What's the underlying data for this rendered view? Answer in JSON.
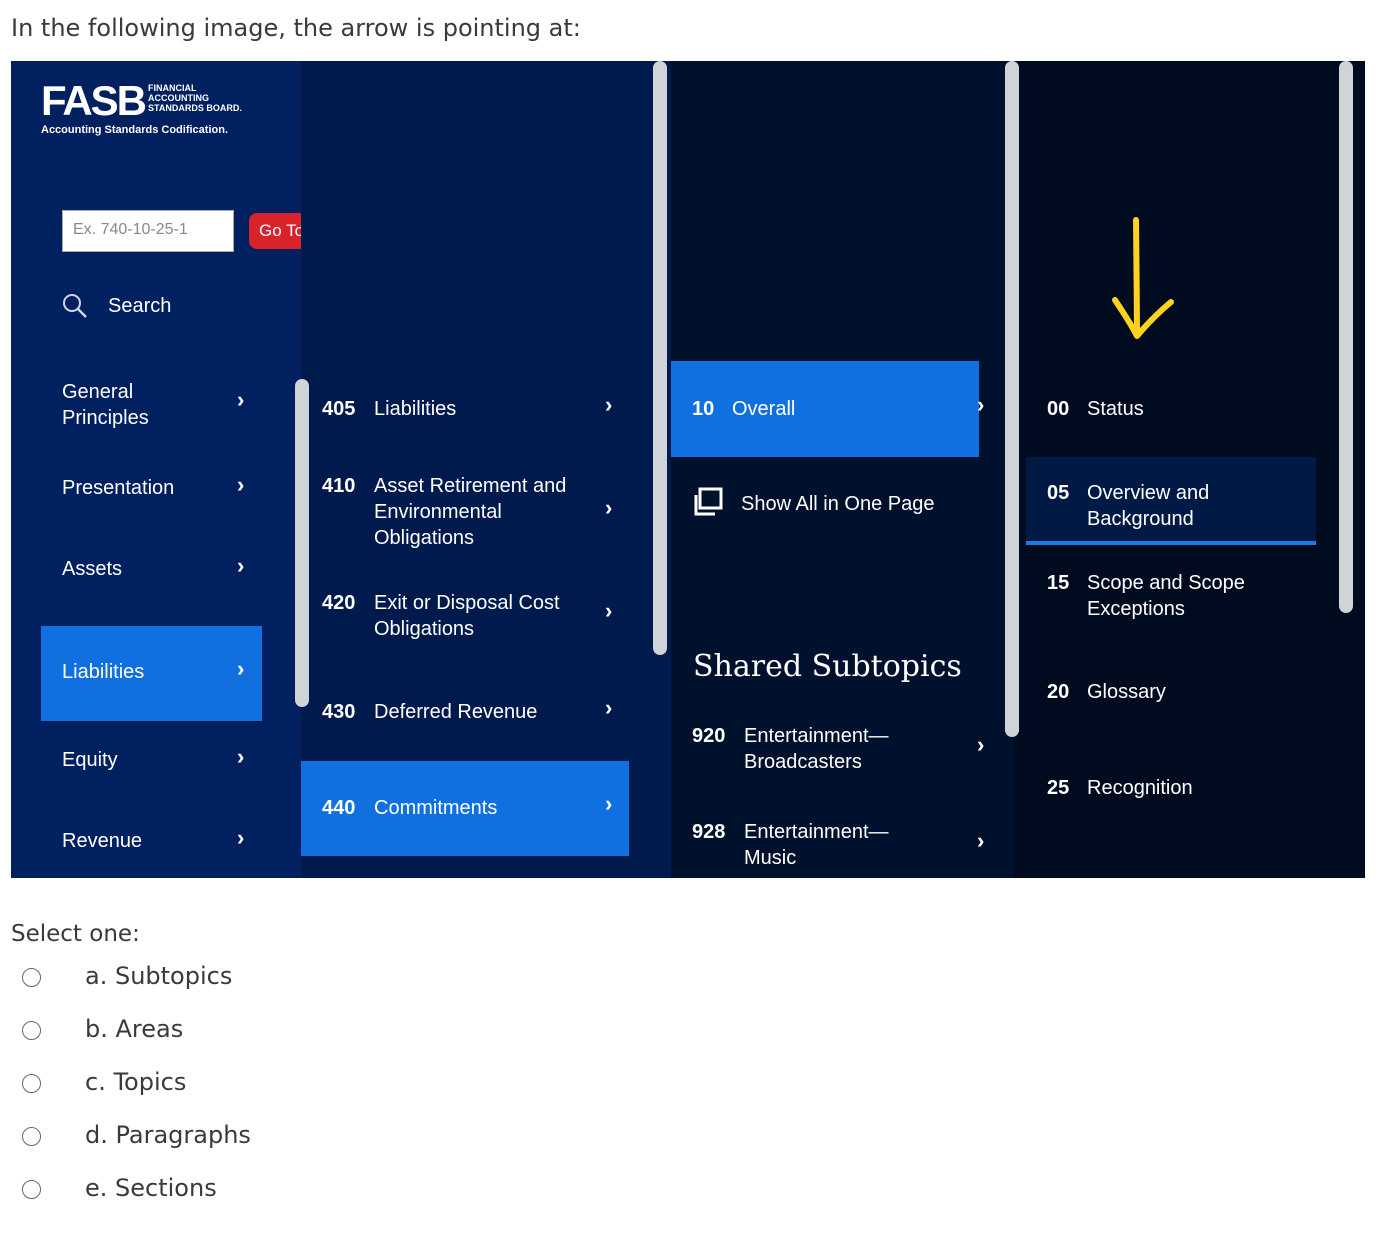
{
  "question": "In the following image, the arrow is pointing at:",
  "screenshot": {
    "logo": {
      "fasb": "FASB",
      "board_lines": [
        "FINANCIAL",
        "ACCOUNTING",
        "STANDARDS BOARD."
      ],
      "codification": "Accounting Standards Codification."
    },
    "goto_placeholder": "Ex. 740-10-25-1",
    "goto_button": "Go To",
    "search_label": "Search",
    "areas": [
      {
        "label": "General Principles"
      },
      {
        "label": "Presentation"
      },
      {
        "label": "Assets"
      },
      {
        "label": "Liabilities"
      },
      {
        "label": "Equity"
      },
      {
        "label": "Revenue"
      }
    ],
    "topics": [
      {
        "num": "405",
        "label": "Liabilities"
      },
      {
        "num": "410",
        "label": "Asset Retirement and Environmental Obligations"
      },
      {
        "num": "420",
        "label": "Exit or Disposal Cost Obligations"
      },
      {
        "num": "430",
        "label": "Deferred Revenue"
      },
      {
        "num": "440",
        "label": "Commitments"
      }
    ],
    "subtopics": {
      "overall": {
        "num": "10",
        "label": "Overall"
      },
      "show_all": "Show All in One Page",
      "shared_heading": "Shared Subtopics",
      "shared": [
        {
          "num": "920",
          "label": "Entertainment— Broadcasters"
        },
        {
          "num": "928",
          "label": "Entertainment— Music"
        }
      ]
    },
    "sections": [
      {
        "num": "00",
        "label": "Status"
      },
      {
        "num": "05",
        "label": "Overview and Background"
      },
      {
        "num": "15",
        "label": "Scope and Scope Exceptions"
      },
      {
        "num": "20",
        "label": "Glossary"
      },
      {
        "num": "25",
        "label": "Recognition"
      }
    ],
    "colors": {
      "active": "#1170e0",
      "arrow": "#ffd21f",
      "go_button": "#d8232a"
    }
  },
  "select_prompt": "Select one:",
  "options": [
    {
      "label": "a. Subtopics"
    },
    {
      "label": "b. Areas"
    },
    {
      "label": "c. Topics"
    },
    {
      "label": "d. Paragraphs"
    },
    {
      "label": "e. Sections"
    }
  ]
}
